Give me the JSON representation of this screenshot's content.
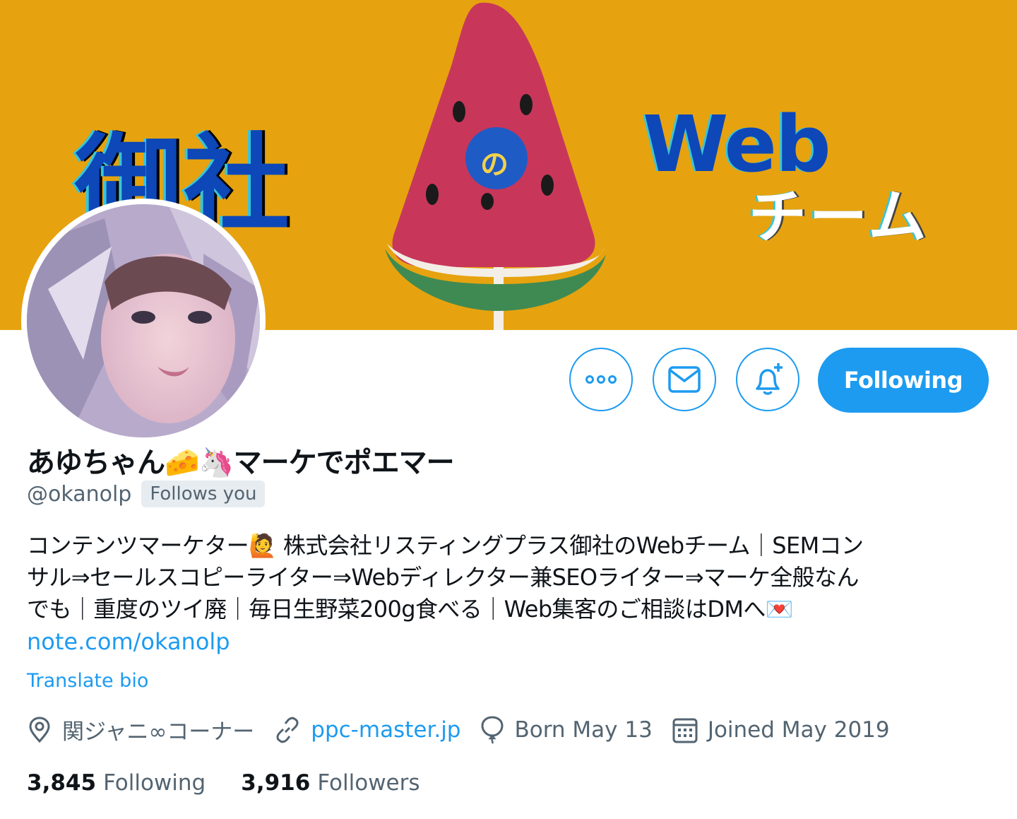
{
  "banner": {
    "title_left": "御社",
    "title_no": "の",
    "title_web": "Web",
    "title_team": "チーム",
    "background_color": "#e6a30f"
  },
  "actions": {
    "more_icon": "more-horizontal-icon",
    "message_icon": "envelope-icon",
    "notify_icon": "bell-plus-icon",
    "following_label": "Following"
  },
  "profile": {
    "name": "あゆちゃん🧀🦄マーケでポエマー",
    "handle": "@okanolp",
    "follows_you": "Follows you",
    "bio_lines": [
      "コンテンツマーケター🙋 株式会社リスティングプラス御社のWebチーム｜SEMコン",
      "サル⇒セールスコピーライター⇒Webディレクター兼SEOライター⇒マーケ全般なん",
      "でも｜重度のツイ廃｜毎日生野菜200g食べる｜Web集客のご相談はDMへ💌"
    ],
    "bio_link": "note.com/okanolp",
    "translate_label": "Translate bio"
  },
  "meta": {
    "location": "関ジャニ∞コーナー",
    "website": "ppc-master.jp",
    "birthday": "Born May 13",
    "joined": "Joined May 2019"
  },
  "stats": {
    "following_count": "3,845",
    "following_label": "Following",
    "followers_count": "3,916",
    "followers_label": "Followers"
  },
  "colors": {
    "accent": "#1d9bf0",
    "secondary_text": "#536471",
    "primary_text": "#0f1419"
  }
}
